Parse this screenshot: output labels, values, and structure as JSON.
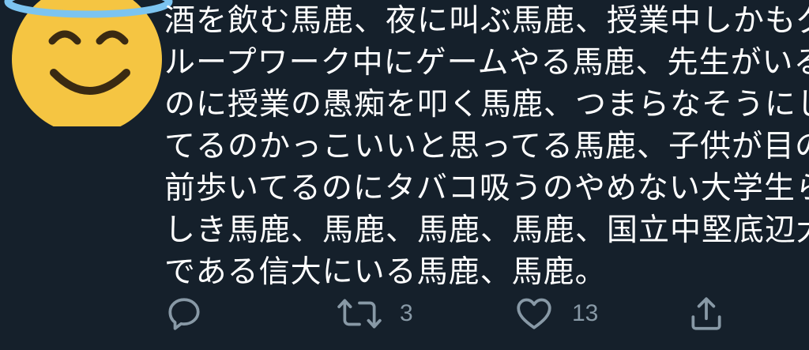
{
  "tweet": {
    "lines": [
      "酒を飲む馬鹿、夜に叫ぶ馬鹿、授業中しかもグ",
      "ループワーク中にゲームやる馬鹿、先生がいる",
      "のに授業の愚痴を叩く馬鹿、つまらなそうにし",
      "てるのかっこいいと思ってる馬鹿、子供が目の",
      "前歩いてるのにタバコ吸うのやめない大学生ら",
      "しき馬鹿、馬鹿、馬鹿、馬鹿、国立中堅底辺大",
      "である信大にいる馬鹿、馬鹿。"
    ]
  },
  "actions": {
    "reply": {
      "icon": "reply-icon",
      "count": ""
    },
    "retweet": {
      "icon": "retweet-icon",
      "count": "3"
    },
    "like": {
      "icon": "heart-icon",
      "count": "13"
    },
    "share": {
      "icon": "share-icon"
    }
  },
  "colors": {
    "background": "#15202b",
    "text": "#ffffff",
    "muted": "#8899a6",
    "avatar_face": "#f5c542",
    "halo": "#7cc4f0"
  }
}
